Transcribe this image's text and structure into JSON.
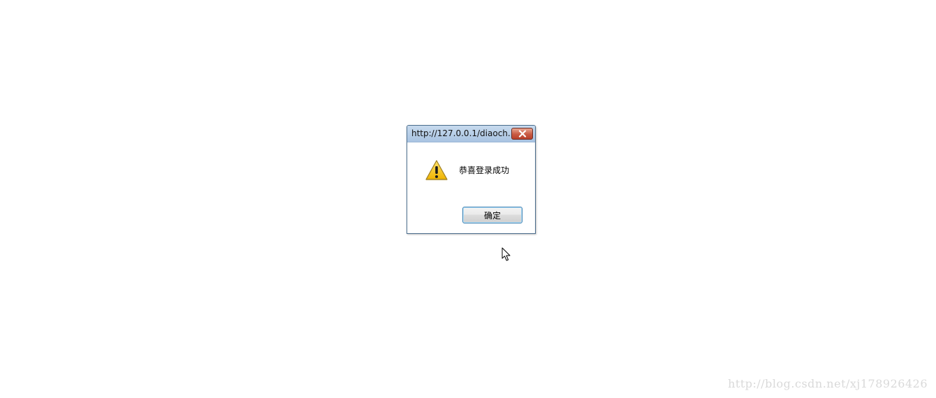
{
  "dialog": {
    "title": "http://127.0.0.1/diaoch...",
    "message": "恭喜登录成功",
    "ok_label": "确定",
    "icon": "warning-icon",
    "close_icon": "close-icon"
  },
  "cursor_icon": "mouse-pointer-icon",
  "watermark": "http://blog.csdn.net/xj178926426",
  "colors": {
    "titlebar": "#b4cce6",
    "close_button": "#c85a43",
    "ok_button_border": "#3c7fb1",
    "warning_yellow": "#f5c400"
  }
}
